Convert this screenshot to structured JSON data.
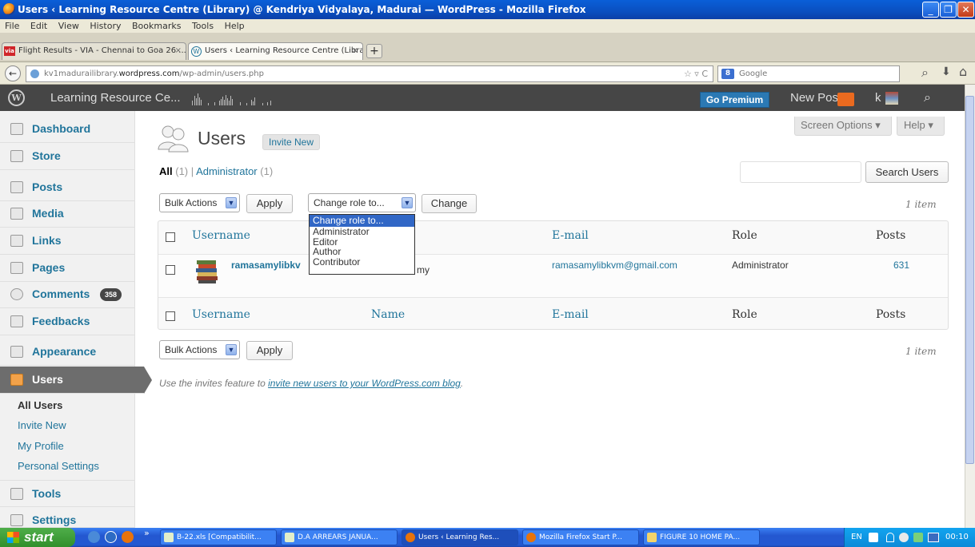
{
  "window": {
    "title": "Users ‹ Learning Resource Centre (Library) @ Kendriya Vidyalaya, Madurai — WordPress - Mozilla Firefox",
    "minimize": "_",
    "maximize": "❐",
    "close": "✕"
  },
  "menubar": [
    "File",
    "Edit",
    "View",
    "History",
    "Bookmarks",
    "Tools",
    "Help"
  ],
  "tabs": [
    {
      "label": "Flight Results - VIA - Chennai to Goa 26 ...",
      "close": "×"
    },
    {
      "label": "Users ‹ Learning Resource Centre (Librar...",
      "close": "×"
    }
  ],
  "new_tab": "+",
  "nav": {
    "back": "←",
    "url_prefix": "kv1madurailibrary.",
    "url_domain": "wordpress.com",
    "url_path": "/wp-admin/users.php",
    "search_engine": "Google",
    "search_glyph": "⌕",
    "download_glyph": "⬇",
    "home_glyph": "⌂",
    "star_glyph": "☆ ▿ C"
  },
  "adminbar": {
    "wp_logo": "W",
    "site_name": "Learning Resource Ce...",
    "go_premium": "Go Premium",
    "new_post": "New Post",
    "user_initial": "k",
    "search_glyph": "⌕"
  },
  "sidebar": {
    "items": [
      {
        "label": "Dashboard"
      },
      {
        "label": "Store"
      },
      {
        "label": "Posts"
      },
      {
        "label": "Media"
      },
      {
        "label": "Links"
      },
      {
        "label": "Pages"
      },
      {
        "label": "Comments",
        "badge": "358"
      },
      {
        "label": "Feedbacks"
      },
      {
        "label": "Appearance"
      },
      {
        "label": "Users"
      },
      {
        "label": "Tools"
      },
      {
        "label": "Settings"
      }
    ],
    "submenu": [
      "All Users",
      "Invite New",
      "My Profile",
      "Personal Settings"
    ]
  },
  "page": {
    "title": "Users",
    "invite_new": "Invite New",
    "screen_options": "Screen Options ▾",
    "help": "Help ▾",
    "filter_all": "All",
    "filter_all_count": "(1)",
    "filter_sep": "|",
    "filter_admin": "Administrator",
    "filter_admin_count": "(1)",
    "search_button": "Search Users",
    "bulk_actions": "Bulk Actions",
    "apply": "Apply",
    "change_role_to": "Change role to...",
    "change": "Change",
    "item_count": "1 item",
    "role_options": [
      "Change role to...",
      "Administrator",
      "Editor",
      "Author",
      "Contributor"
    ],
    "columns": {
      "username": "Username",
      "name": "Name",
      "email": "E-mail",
      "role": "Role",
      "posts": "Posts"
    },
    "rows": [
      {
        "username": "ramasamylibkv",
        "name_visible": "my",
        "email": "ramasamylibkvm@gmail.com",
        "role": "Administrator",
        "posts": "631"
      }
    ],
    "invite_note_pre": "Use the invites feature to ",
    "invite_note_link": "invite new users to your WordPress.com blog",
    "invite_note_post": "."
  },
  "taskbar": {
    "start": "start",
    "arrows": "»",
    "tasks": [
      {
        "label": "B-22.xls [Compatibilit..."
      },
      {
        "label": "D.A ARREARS JANUA..."
      },
      {
        "label": "Users ‹ Learning Res..."
      },
      {
        "label": "Mozilla Firefox Start P..."
      },
      {
        "label": "FIGURE 10 HOME PA..."
      }
    ],
    "lang": "EN",
    "time": "00:10"
  },
  "colors": {
    "link": "#21759b",
    "adminbar": "#464646",
    "premium": "#2b79b4",
    "badge": "#464646",
    "notif": "#ea6a1f"
  }
}
